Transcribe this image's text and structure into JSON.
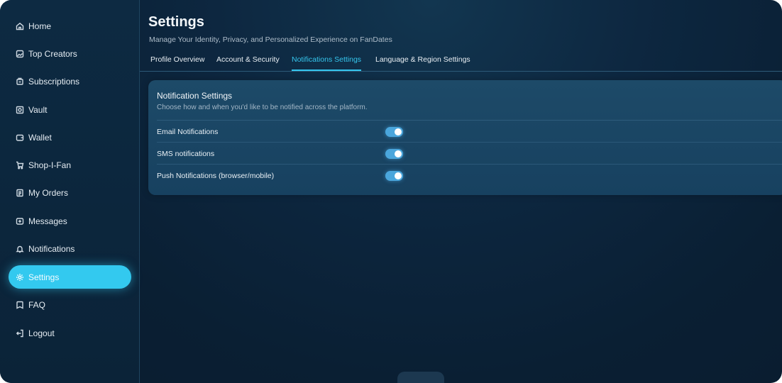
{
  "sidebar": {
    "items": [
      {
        "label": "Home",
        "icon": "home-icon",
        "active": false
      },
      {
        "label": "Top Creators",
        "icon": "image-icon",
        "active": false
      },
      {
        "label": "Subscriptions",
        "icon": "subscriptions-icon",
        "active": false
      },
      {
        "label": "Vault",
        "icon": "vault-icon",
        "active": false
      },
      {
        "label": "Wallet",
        "icon": "wallet-icon",
        "active": false
      },
      {
        "label": "Shop-I-Fan",
        "icon": "cart-icon",
        "active": false
      },
      {
        "label": "My Orders",
        "icon": "orders-icon",
        "active": false
      },
      {
        "label": "Messages",
        "icon": "messages-icon",
        "active": false
      },
      {
        "label": "Notifications",
        "icon": "bell-icon",
        "active": false
      },
      {
        "label": "Settings",
        "icon": "gear-icon",
        "active": true
      },
      {
        "label": "FAQ",
        "icon": "faq-icon",
        "active": false
      },
      {
        "label": "Logout",
        "icon": "logout-icon",
        "active": false
      }
    ]
  },
  "header": {
    "title": "Settings",
    "subtitle": "Manage Your Identity, Privacy, and Personalized Experience on FanDates"
  },
  "tabs": [
    {
      "label": "Profile Overview",
      "active": false
    },
    {
      "label": "Account & Security",
      "active": false
    },
    {
      "label": "Notifications Settings",
      "active": true
    },
    {
      "label": "Language & Region Settings",
      "active": false
    }
  ],
  "notifications_card": {
    "title": "Notification Settings",
    "description": "Choose how and when you'd like to be notified across the platform.",
    "options": [
      {
        "label": "Email Notifications",
        "enabled": true
      },
      {
        "label": "SMS notifications",
        "enabled": true
      },
      {
        "label": "Push Notifications (browser/mobile)",
        "enabled": true
      }
    ]
  },
  "colors": {
    "accent": "#33c9ef",
    "background": "#0a1f33",
    "card": "#1d4a68",
    "toggle_on": "#4aa6dc"
  }
}
